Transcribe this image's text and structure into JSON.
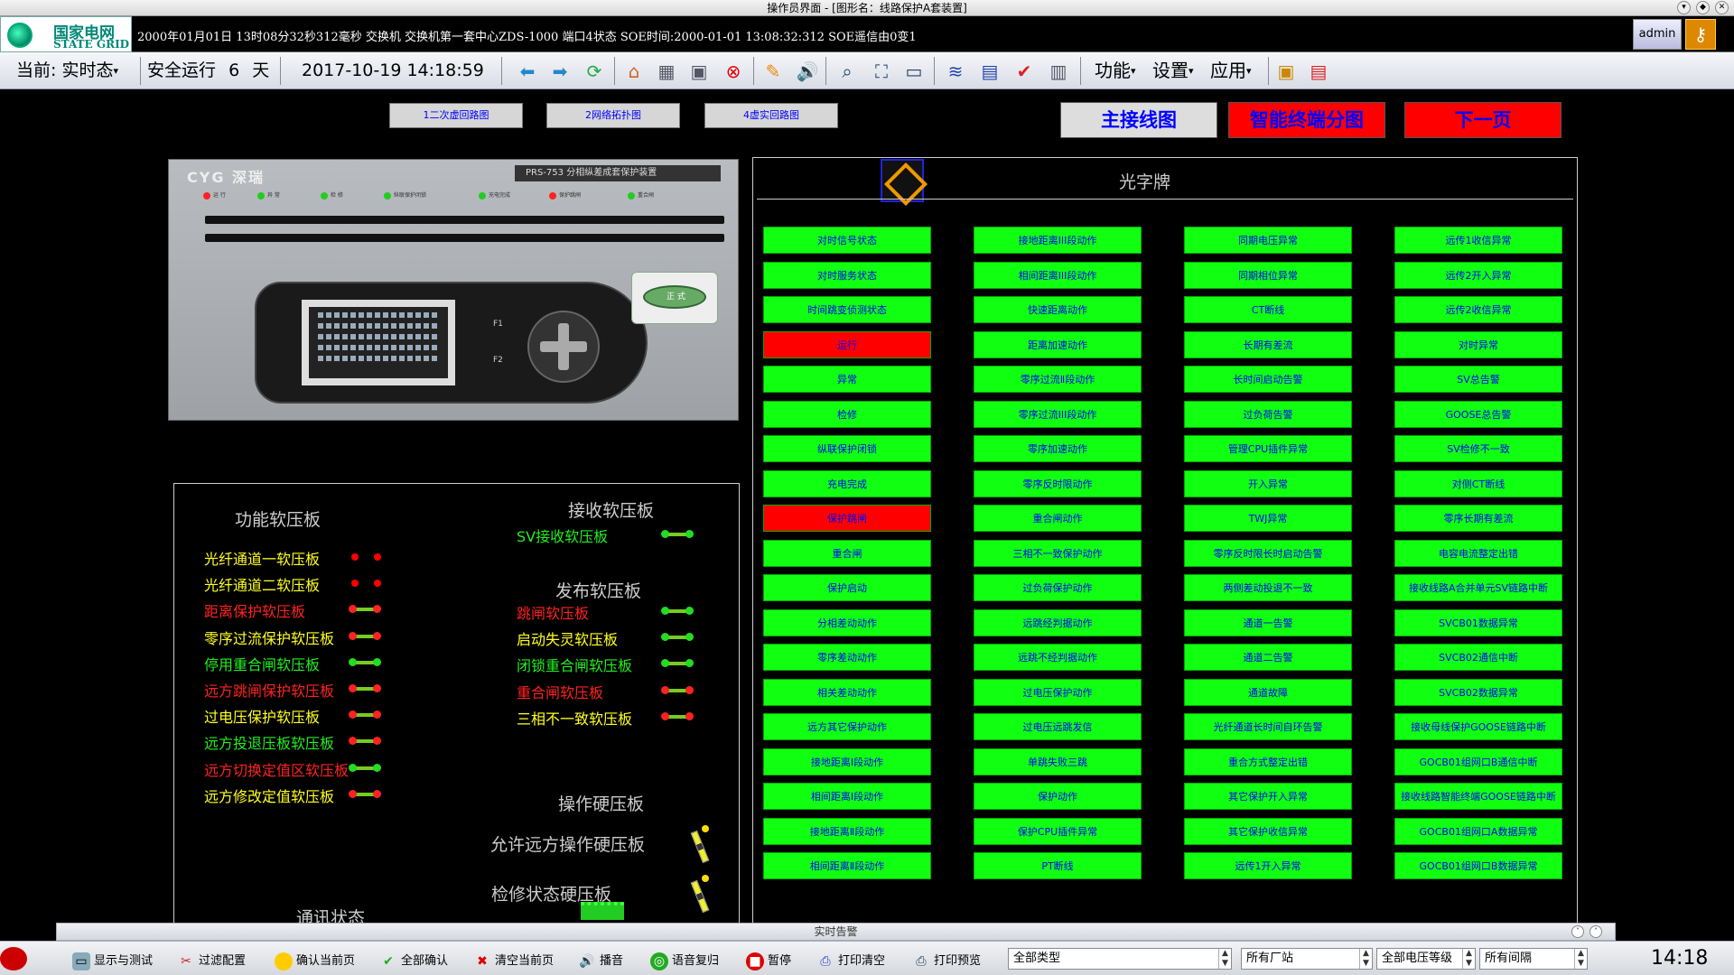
{
  "window": {
    "title": "操作员界面 - [图形名：线路保护A套装置]"
  },
  "logo": {
    "cn": "国家电网",
    "en": "STATE GRID"
  },
  "infobar": {
    "text": "2000年01月01日 13时08分32秒312毫秒   交换机 交换机第一套中心ZDS-1000 端口4状态   SOE时间:2000-01-01 13:08:32:312 SOE遥信由0变1",
    "user": "admin"
  },
  "toolbar": {
    "mode_prefix": "当前:",
    "mode": "实时态",
    "safe_run": "安全运行",
    "safe_days": "6",
    "days_unit": "天",
    "datetime": "2017-10-19 14:18:59",
    "menus": [
      "功能",
      "设置",
      "应用"
    ]
  },
  "nav": {
    "buttons": [
      "1二次虚回路图",
      "2网络拓扑图",
      "4虚实回路图"
    ],
    "main_wiring": "主接线图",
    "smart_terminal": "智能终端分图",
    "next_page": "下一页"
  },
  "colors": {
    "ok": "#11ff11",
    "alarm": "#ff0000",
    "on": "#77cc22",
    "text_red": "#ff2222",
    "text_yellow": "#ffff22",
    "text_green": "#22ee22"
  },
  "device": {
    "brand": "CYG 深瑞",
    "model": "PRS-753 分相纵差成套保护装置",
    "leds": [
      "运 行",
      "异 常",
      "检 修",
      "纵联保护闭锁",
      "充电完成",
      "保护跳闸",
      "重合闸"
    ],
    "sticker": "正 式",
    "keys": [
      "F1",
      "F2"
    ]
  },
  "softboards": {
    "function_title": "功能软压板",
    "function_items": [
      {
        "label": "光纤通道一软压板",
        "color": "#ffff22",
        "state": "dots"
      },
      {
        "label": "光纤通道二软压板",
        "color": "#ffff22",
        "state": "dots"
      },
      {
        "label": "距离保护软压板",
        "color": "#ff2222",
        "state": "red"
      },
      {
        "label": "零序过流保护软压板",
        "color": "#ffff22",
        "state": "red"
      },
      {
        "label": "停用重合闸软压板",
        "color": "#22ee22",
        "state": "green"
      },
      {
        "label": "远方跳闸保护软压板",
        "color": "#ff2222",
        "state": "red"
      },
      {
        "label": "过电压保护软压板",
        "color": "#ffff22",
        "state": "red"
      },
      {
        "label": "远方投退压板软压板",
        "color": "#22ee22",
        "state": "red"
      },
      {
        "label": "远方切换定值区软压板",
        "color": "#ff2222",
        "state": "green"
      },
      {
        "label": "远方修改定值软压板",
        "color": "#ffff22",
        "state": "red"
      }
    ],
    "receive_title": "接收软压板",
    "receive_items": [
      {
        "label": "SV接收软压板",
        "color": "#22ee22",
        "state": "green"
      }
    ],
    "publish_title": "发布软压板",
    "publish_items": [
      {
        "label": "跳闸软压板",
        "color": "#ff2222",
        "state": "green"
      },
      {
        "label": "启动失灵软压板",
        "color": "#ffff22",
        "state": "green"
      },
      {
        "label": "闭锁重合闸软压板",
        "color": "#22ee22",
        "state": "green"
      },
      {
        "label": "重合闸软压板",
        "color": "#ff2222",
        "state": "red"
      },
      {
        "label": "三相不一致软压板",
        "color": "#ffff22",
        "state": "red"
      }
    ],
    "hardboard_title": "操作硬压板",
    "hardboard_items": [
      "允许远方操作硬压板",
      "检修状态硬压板"
    ],
    "comm_status": "通讯状态"
  },
  "guangzipai": {
    "title": "光字牌",
    "columns": [
      [
        {
          "label": "对时信号状态",
          "state": "green"
        },
        {
          "label": "对时服务状态",
          "state": "green"
        },
        {
          "label": "时间跳变侦测状态",
          "state": "green"
        },
        {
          "label": "运行",
          "state": "red"
        },
        {
          "label": "异常",
          "state": "green"
        },
        {
          "label": "检修",
          "state": "green"
        },
        {
          "label": "纵联保护闭锁",
          "state": "green"
        },
        {
          "label": "充电完成",
          "state": "green"
        },
        {
          "label": "保护跳闸",
          "state": "red"
        },
        {
          "label": "重合闸",
          "state": "green"
        },
        {
          "label": "保护启动",
          "state": "green"
        },
        {
          "label": "分相差动动作",
          "state": "green"
        },
        {
          "label": "零序差动动作",
          "state": "green"
        },
        {
          "label": "相关差动动作",
          "state": "green"
        },
        {
          "label": "远方其它保护动作",
          "state": "green"
        },
        {
          "label": "接地距离Ⅰ段动作",
          "state": "green"
        },
        {
          "label": "相间距离Ⅰ段动作",
          "state": "green"
        },
        {
          "label": "接地距离Ⅱ段动作",
          "state": "green"
        },
        {
          "label": "相间距离Ⅱ段动作",
          "state": "green"
        }
      ],
      [
        {
          "label": "接地距离III段动作",
          "state": "green"
        },
        {
          "label": "相间距离III段动作",
          "state": "green"
        },
        {
          "label": "快速距离动作",
          "state": "green"
        },
        {
          "label": "距离加速动作",
          "state": "green"
        },
        {
          "label": "零序过流Ⅱ段动作",
          "state": "green"
        },
        {
          "label": "零序过流III段动作",
          "state": "green"
        },
        {
          "label": "零序加速动作",
          "state": "green"
        },
        {
          "label": "零序反时限动作",
          "state": "green"
        },
        {
          "label": "重合闸动作",
          "state": "green"
        },
        {
          "label": "三相不一致保护动作",
          "state": "green"
        },
        {
          "label": "过负荷保护动作",
          "state": "green"
        },
        {
          "label": "远跳经判据动作",
          "state": "green"
        },
        {
          "label": "远跳不经判据动作",
          "state": "green"
        },
        {
          "label": "过电压保护动作",
          "state": "green"
        },
        {
          "label": "过电压远跳发信",
          "state": "green"
        },
        {
          "label": "单跳失败三跳",
          "state": "green"
        },
        {
          "label": "保护动作",
          "state": "green"
        },
        {
          "label": "保护CPU插件异常",
          "state": "green"
        },
        {
          "label": "PT断线",
          "state": "green"
        }
      ],
      [
        {
          "label": "同期电压异常",
          "state": "green"
        },
        {
          "label": "同期相位异常",
          "state": "green"
        },
        {
          "label": "CT断线",
          "state": "green"
        },
        {
          "label": "长期有差流",
          "state": "green"
        },
        {
          "label": "长时间启动告警",
          "state": "green"
        },
        {
          "label": "过负荷告警",
          "state": "green"
        },
        {
          "label": "管理CPU插件异常",
          "state": "green"
        },
        {
          "label": "开入异常",
          "state": "green"
        },
        {
          "label": "TWJ异常",
          "state": "green"
        },
        {
          "label": "零序反时限长时启动告警",
          "state": "green"
        },
        {
          "label": "两侧差动投退不一致",
          "state": "green"
        },
        {
          "label": "通道一告警",
          "state": "green"
        },
        {
          "label": "通道二告警",
          "state": "green"
        },
        {
          "label": "通道故障",
          "state": "green"
        },
        {
          "label": "光纤通道长时间自环告警",
          "state": "green"
        },
        {
          "label": "重合方式整定出错",
          "state": "green"
        },
        {
          "label": "其它保护开入异常",
          "state": "green"
        },
        {
          "label": "其它保护收信异常",
          "state": "green"
        },
        {
          "label": "远传1开入异常",
          "state": "green"
        }
      ],
      [
        {
          "label": "远传1收信异常",
          "state": "green"
        },
        {
          "label": "远传2开入异常",
          "state": "green"
        },
        {
          "label": "远传2收信异常",
          "state": "green"
        },
        {
          "label": "对时异常",
          "state": "green"
        },
        {
          "label": "SV总告警",
          "state": "green"
        },
        {
          "label": "GOOSE总告警",
          "state": "green"
        },
        {
          "label": "SV检修不一致",
          "state": "green"
        },
        {
          "label": "对侧CT断线",
          "state": "green"
        },
        {
          "label": "零序长期有差流",
          "state": "green"
        },
        {
          "label": "电容电流整定出错",
          "state": "green"
        },
        {
          "label": "接收线路A合并单元SV链路中断",
          "state": "green"
        },
        {
          "label": "SVCB01数据异常",
          "state": "green"
        },
        {
          "label": "SVCB02通信中断",
          "state": "green"
        },
        {
          "label": "SVCB02数据异常",
          "state": "green"
        },
        {
          "label": "接收母线保护GOOSE链路中断",
          "state": "green"
        },
        {
          "label": "GOCB01组网口B通信中断",
          "state": "green"
        },
        {
          "label": "接收线路智能终端GOOSE链路中断",
          "state": "green"
        },
        {
          "label": "GOCB01组网口A数据异常",
          "state": "green"
        },
        {
          "label": "GOCB01组网口B数据异常",
          "state": "green"
        }
      ]
    ]
  },
  "alarm_window": {
    "title": "实时告警"
  },
  "taskbar": {
    "buttons": [
      "显示与测试",
      "过滤配置",
      "确认当前页",
      "全部确认",
      "清空当前页",
      "播音",
      "语音复归",
      "暂停",
      "打印清空",
      "打印预览"
    ],
    "filters": [
      "全部类型",
      "所有厂站",
      "全部电压等级",
      "所有间隔"
    ],
    "clock": "14:18"
  }
}
